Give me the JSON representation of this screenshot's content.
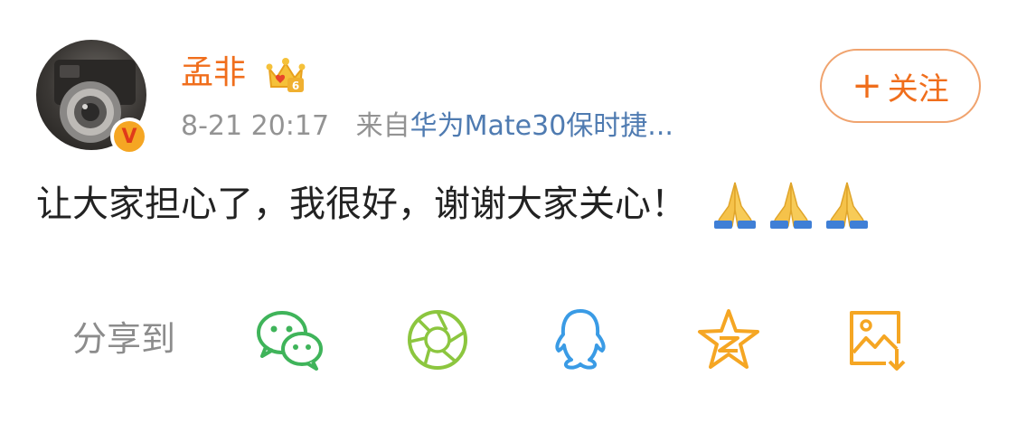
{
  "user": {
    "name": "孟非",
    "verified": true
  },
  "post": {
    "time": "8-21 20:17",
    "source_prefix": "来自",
    "source_device": "华为Mate30保时捷...",
    "text": "让大家担心了，我很好，谢谢大家关心！",
    "emojis": [
      "pray-icon",
      "pray-icon",
      "pray-icon"
    ]
  },
  "follow": {
    "plus": "+",
    "label": "关注"
  },
  "share": {
    "label": "分享到",
    "targets": [
      {
        "name": "wechat-icon",
        "color": "#3fb45a"
      },
      {
        "name": "wechat-moments-icon",
        "color": "#8cc63f"
      },
      {
        "name": "qq-icon",
        "color": "#3a9be5"
      },
      {
        "name": "qzone-icon",
        "color": "#f5a623"
      },
      {
        "name": "save-image-icon",
        "color": "#f5a623"
      }
    ]
  },
  "colors": {
    "username": "#f06e1c",
    "link": "#4f7bb1",
    "meta": "#939393",
    "follow_border": "#f0a36e"
  }
}
